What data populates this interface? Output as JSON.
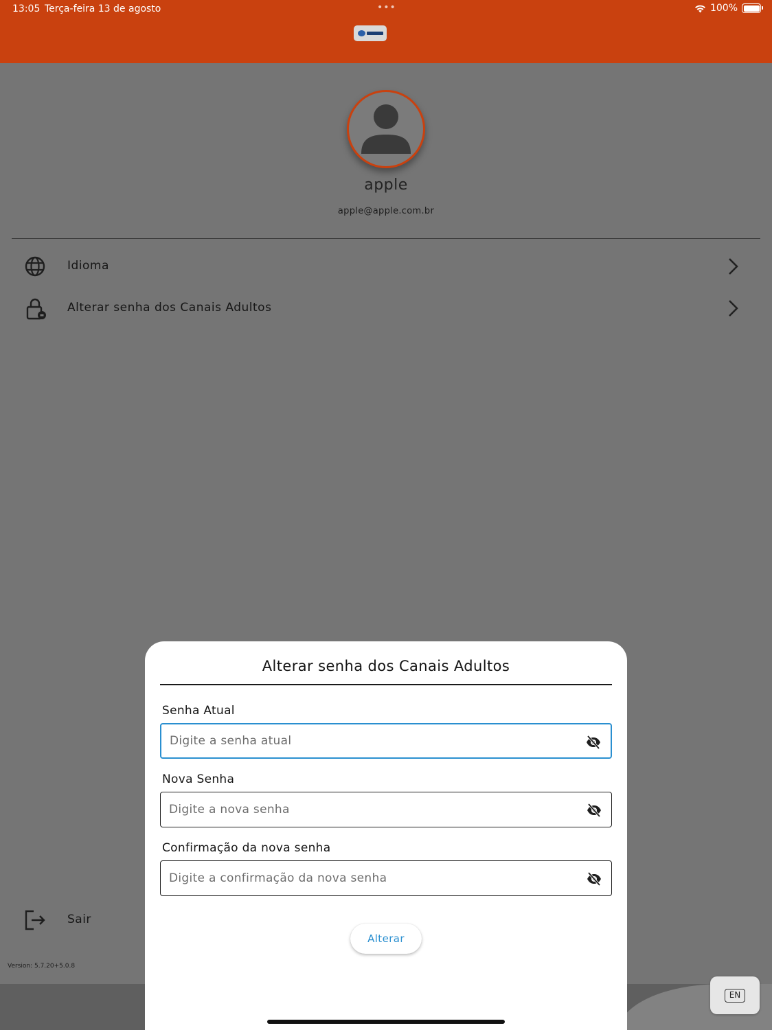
{
  "status_bar": {
    "time": "13:05",
    "date": "Terça-feira 13 de agosto",
    "battery": "100%",
    "battery_level": 1.0
  },
  "header": {
    "logo_icon": "maximus-logo-icon",
    "color": "#c9410f"
  },
  "profile": {
    "name": "apple",
    "email": "apple@apple.com.br",
    "avatar_icon": "person-avatar-icon"
  },
  "menu": {
    "items": [
      {
        "label": "Idioma",
        "icon": "globe-icon"
      },
      {
        "label": "Alterar senha dos Canais Adultos",
        "icon": "lock-icon"
      }
    ],
    "logout_label": "Sair"
  },
  "version": "Version: 5.7.20+5.0.8",
  "modal": {
    "title": "Alterar senha dos Canais Adultos",
    "fields": [
      {
        "label": "Senha Atual",
        "placeholder": "Digite a senha atual",
        "value": ""
      },
      {
        "label": "Nova Senha",
        "placeholder": "Digite a nova senha",
        "value": ""
      },
      {
        "label": "Confirmação da nova senha",
        "placeholder": "Digite a confirmação da nova senha",
        "value": ""
      }
    ],
    "submit_label": "Alterar",
    "accent": "#2a8fd0"
  },
  "keyboard_badge": "EN"
}
